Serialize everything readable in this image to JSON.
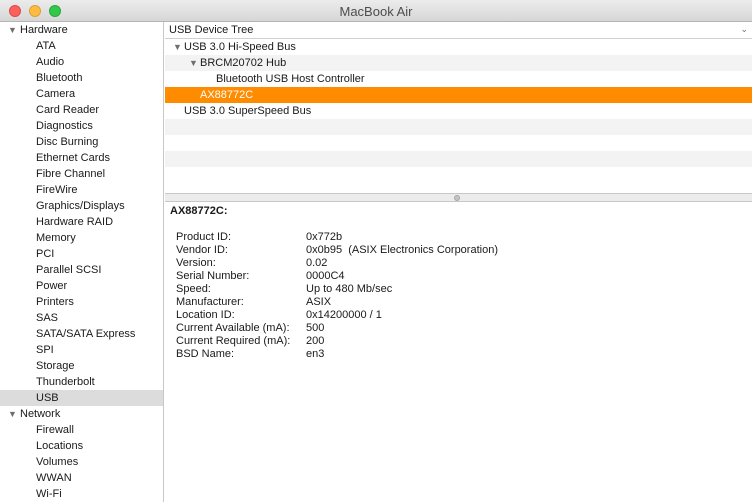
{
  "window": {
    "title": "MacBook Air"
  },
  "sidebar": {
    "sections": [
      {
        "label": "Hardware",
        "items": [
          "ATA",
          "Audio",
          "Bluetooth",
          "Camera",
          "Card Reader",
          "Diagnostics",
          "Disc Burning",
          "Ethernet Cards",
          "Fibre Channel",
          "FireWire",
          "Graphics/Displays",
          "Hardware RAID",
          "Memory",
          "PCI",
          "Parallel SCSI",
          "Power",
          "Printers",
          "SAS",
          "SATA/SATA Express",
          "SPI",
          "Storage",
          "Thunderbolt",
          "USB"
        ]
      },
      {
        "label": "Network",
        "items": [
          "Firewall",
          "Locations",
          "Volumes",
          "WWAN",
          "Wi-Fi"
        ]
      }
    ],
    "selected": "USB"
  },
  "tree": {
    "header": "USB Device Tree",
    "rows": [
      {
        "label": "USB 3.0 Hi-Speed Bus",
        "depth": 0,
        "expandable": true
      },
      {
        "label": "BRCM20702 Hub",
        "depth": 1,
        "expandable": true
      },
      {
        "label": "Bluetooth USB Host Controller",
        "depth": 2,
        "expandable": false
      },
      {
        "label": "AX88772C",
        "depth": 1,
        "expandable": false,
        "selected": true
      },
      {
        "label": "USB 3.0 SuperSpeed Bus",
        "depth": 0,
        "expandable": false
      }
    ]
  },
  "detail": {
    "title": "AX88772C:",
    "properties": [
      {
        "key": "Product ID:",
        "value": "0x772b"
      },
      {
        "key": "Vendor ID:",
        "value": "0x0b95  (ASIX Electronics Corporation)"
      },
      {
        "key": "Version:",
        "value": "0.02"
      },
      {
        "key": "Serial Number:",
        "value": "0000C4"
      },
      {
        "key": "Speed:",
        "value": "Up to 480 Mb/sec"
      },
      {
        "key": "Manufacturer:",
        "value": "ASIX"
      },
      {
        "key": "Location ID:",
        "value": "0x14200000 / 1"
      },
      {
        "key": "Current Available (mA):",
        "value": "500"
      },
      {
        "key": "Current Required (mA):",
        "value": "200"
      },
      {
        "key": "BSD Name:",
        "value": "en3"
      }
    ]
  },
  "colors": {
    "selection": "#ff8b00",
    "sidebar_selection": "#dcdcdc"
  }
}
